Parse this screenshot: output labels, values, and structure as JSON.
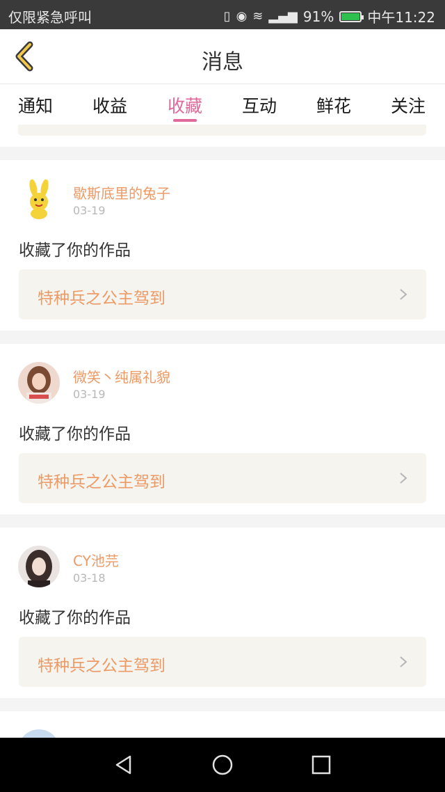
{
  "status_bar": {
    "left_text": "仅限紧急呼叫",
    "battery": "91%",
    "time": "中午11:22",
    "battery_level": 0.91,
    "battery_color": "#2ec04f"
  },
  "header": {
    "title": "消息"
  },
  "tabs": [
    {
      "label": "通知"
    },
    {
      "label": "收益"
    },
    {
      "label": "收藏"
    },
    {
      "label": "互动"
    },
    {
      "label": "鲜花"
    },
    {
      "label": "关注"
    }
  ],
  "active_tab": "收藏",
  "items": [
    {
      "user": "歇斯底里的兔子",
      "date": "03-19",
      "action": "收藏了你的作品",
      "work": "特种兵之公主驾到"
    },
    {
      "user": "微笑丶纯属礼貌",
      "date": "03-19",
      "action": "收藏了你的作品",
      "work": "特种兵之公主驾到"
    },
    {
      "user": "CY池芫",
      "date": "03-18",
      "action": "收藏了你的作品",
      "work": "特种兵之公主驾到"
    }
  ],
  "colors": {
    "accent": "#e0689b",
    "name": "#ec9a66",
    "work_bg": "#f5f4ef"
  }
}
